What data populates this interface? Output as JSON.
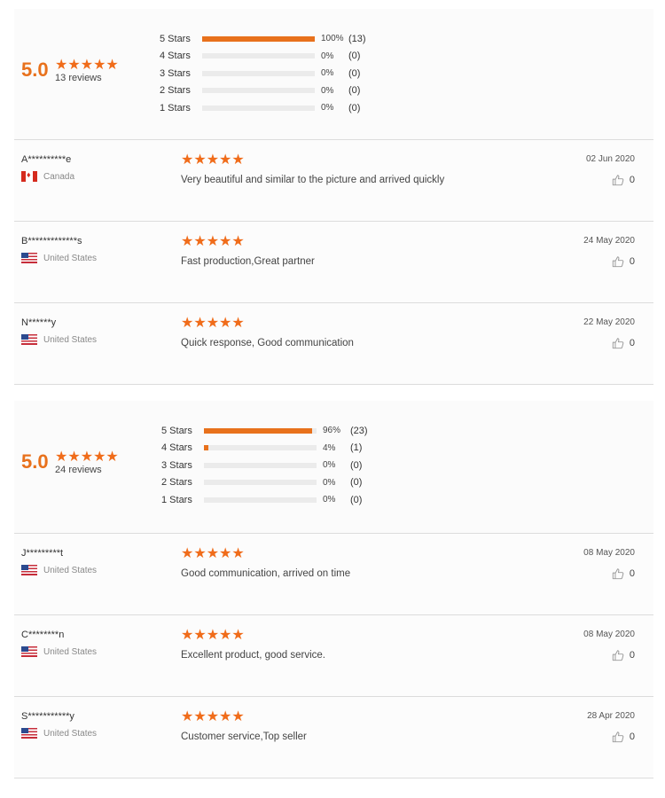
{
  "star_glyph": "★★★★★",
  "colors": {
    "accent": "#e8711c",
    "bar_bg": "#ebebeb"
  },
  "sections": [
    {
      "average": "5.0",
      "review_count": "13 reviews",
      "distribution": [
        {
          "label": "5 Stars",
          "fraction": 1.0,
          "pct": "100%",
          "count": "(13)"
        },
        {
          "label": "4 Stars",
          "fraction": 0.0,
          "pct": "0%",
          "count": "(0)"
        },
        {
          "label": "3 Stars",
          "fraction": 0.0,
          "pct": "0%",
          "count": "(0)"
        },
        {
          "label": "2 Stars",
          "fraction": 0.0,
          "pct": "0%",
          "count": "(0)"
        },
        {
          "label": "1 Stars",
          "fraction": 0.0,
          "pct": "0%",
          "count": "(0)"
        }
      ],
      "reviews": [
        {
          "name": "A**********e",
          "country": "Canada",
          "flag": "ca",
          "rating": 5,
          "text": "Very beautiful and similar to the picture and arrived quickly",
          "date": "02 Jun 2020",
          "likes": "0"
        },
        {
          "name": "B*************s",
          "country": "United States",
          "flag": "us",
          "rating": 5,
          "text": "Fast production,Great partner",
          "date": "24 May 2020",
          "likes": "0"
        },
        {
          "name": "N******y",
          "country": "United States",
          "flag": "us",
          "rating": 5,
          "text": "Quick response, Good communication",
          "date": "22 May 2020",
          "likes": "0"
        }
      ]
    },
    {
      "average": "5.0",
      "review_count": "24 reviews",
      "distribution": [
        {
          "label": "5 Stars",
          "fraction": 0.96,
          "pct": "96%",
          "count": "(23)"
        },
        {
          "label": "4 Stars",
          "fraction": 0.04,
          "pct": "4%",
          "count": "(1)"
        },
        {
          "label": "3 Stars",
          "fraction": 0.0,
          "pct": "0%",
          "count": "(0)"
        },
        {
          "label": "2 Stars",
          "fraction": 0.0,
          "pct": "0%",
          "count": "(0)"
        },
        {
          "label": "1 Stars",
          "fraction": 0.0,
          "pct": "0%",
          "count": "(0)"
        }
      ],
      "reviews": [
        {
          "name": "J*********t",
          "country": "United States",
          "flag": "us",
          "rating": 5,
          "text": "Good communication, arrived on time",
          "date": "08 May 2020",
          "likes": "0"
        },
        {
          "name": "C********n",
          "country": "United States",
          "flag": "us",
          "rating": 5,
          "text": "Excellent product, good service.",
          "date": "08 May 2020",
          "likes": "0"
        },
        {
          "name": "S***********y",
          "country": "United States",
          "flag": "us",
          "rating": 5,
          "text": "Customer service,Top seller",
          "date": "28 Apr 2020",
          "likes": "0"
        }
      ]
    }
  ]
}
